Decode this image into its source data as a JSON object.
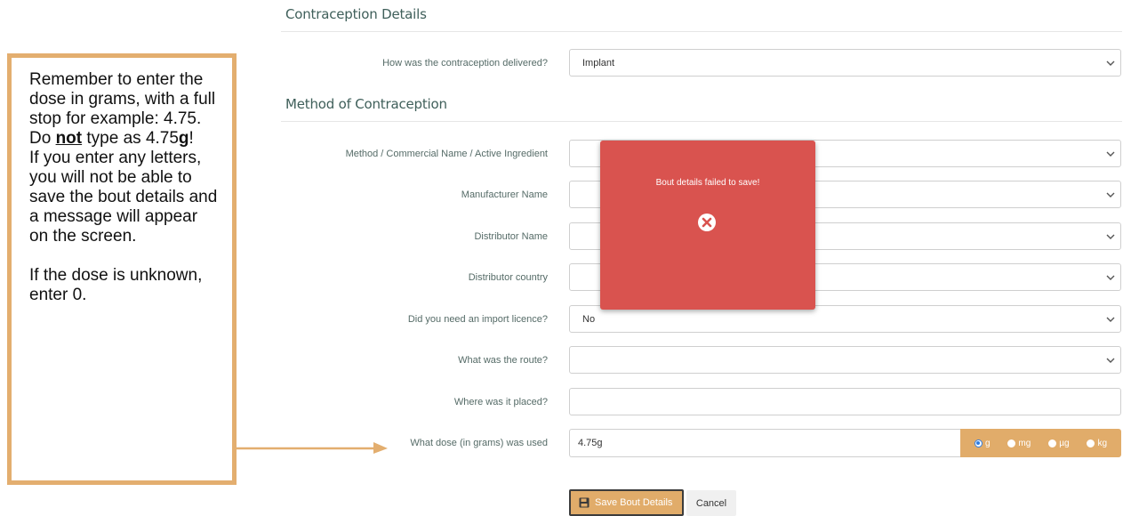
{
  "sections": {
    "contraception_details": "Contraception Details",
    "method_of_contraception": "Method of Contraception"
  },
  "fields": [
    {
      "label": "How was the contraception delivered?",
      "value": "Implant",
      "type": "select"
    },
    {
      "label": "Method / Commercial Name / Active Ingredient",
      "value": "",
      "type": "select"
    },
    {
      "label": "Manufacturer Name",
      "value": "",
      "type": "select"
    },
    {
      "label": "Distributor Name",
      "value": "",
      "type": "select"
    },
    {
      "label": "Distributor country",
      "value": "",
      "type": "select"
    },
    {
      "label": "Did you need an import licence?",
      "value": "No",
      "type": "select"
    },
    {
      "label": "What was the route?",
      "value": "",
      "type": "select"
    },
    {
      "label": "Where was it placed?",
      "value": "",
      "type": "text"
    }
  ],
  "dose": {
    "label": "What dose (in grams) was used",
    "value": "4.75g",
    "units": [
      "g",
      "mg",
      "µg",
      "kg"
    ],
    "selected_unit": "g"
  },
  "buttons": {
    "save": "Save Bout Details",
    "cancel": "Cancel"
  },
  "popup": {
    "message": "Bout details failed to save!",
    "icon": "error-x-circle-icon"
  },
  "note": {
    "line1a": "Remember to enter the dose in grams, with a full stop for example: 4.75.",
    "do": "Do ",
    "not": "not",
    "type_as": " type as 4.75",
    "g": "g",
    "bang": "!",
    "line2": "If you enter any letters, you will not be able to save the bout details and a message will appear on the screen.",
    "line3": "If the dose is unknown, enter 0."
  },
  "colors": {
    "accent": "#e1ac6a",
    "error": "#d9534f",
    "label": "#556b67"
  }
}
